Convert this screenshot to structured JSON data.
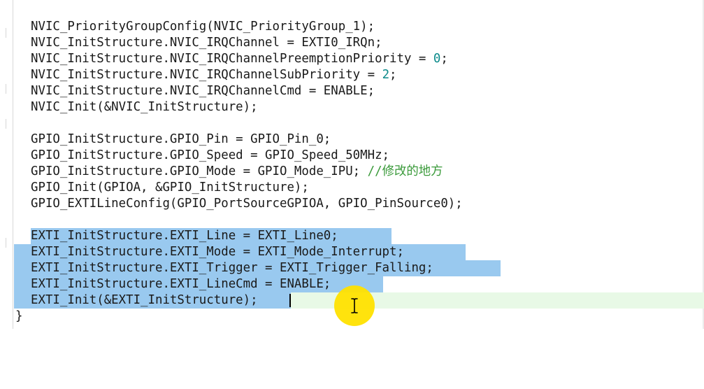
{
  "editor": {
    "lines": [
      {
        "text": "NVIC_PriorityGroupConfig(NVIC_PriorityGroup_1);"
      },
      {
        "text": "NVIC_InitStructure.NVIC_IRQChannel = EXTI0_IRQn;"
      },
      {
        "pre": "NVIC_InitStructure.NVIC_IRQChannelPreemptionPriority = ",
        "num": "0",
        "post": ";"
      },
      {
        "pre": "NVIC_InitStructure.NVIC_IRQChannelSubPriority = ",
        "num": "2",
        "post": ";"
      },
      {
        "text": "NVIC_InitStructure.NVIC_IRQChannelCmd = ENABLE;"
      },
      {
        "text": "NVIC_Init(&NVIC_InitStructure);"
      },
      {
        "text": ""
      },
      {
        "text": "GPIO_InitStructure.GPIO_Pin = GPIO_Pin_0;"
      },
      {
        "text": "GPIO_InitStructure.GPIO_Speed = GPIO_Speed_50MHz;"
      },
      {
        "pre": "GPIO_InitStructure.GPIO_Mode = GPIO_Mode_IPU; ",
        "comment": "//修改的地方"
      },
      {
        "text": "GPIO_Init(GPIOA, &GPIO_InitStructure);"
      },
      {
        "text": "GPIO_EXTILineConfig(GPIO_PortSourceGPIOA, GPIO_PinSource0);"
      },
      {
        "text": ""
      },
      {
        "text": "EXTI_InitStructure.EXTI_Line = EXTI_Line0;"
      },
      {
        "text": "EXTI_InitStructure.EXTI_Mode = EXTI_Mode_Interrupt;"
      },
      {
        "text": "EXTI_InitStructure.EXTI_Trigger = EXTI_Trigger_Falling;"
      },
      {
        "text": "EXTI_InitStructure.EXTI_LineCmd = ENABLE;"
      },
      {
        "text": "EXTI_Init(&EXTI_InitStructure);"
      },
      {
        "text": "}"
      }
    ]
  },
  "colors": {
    "selection": "#99c9ef",
    "current_line": "#e8f9e6",
    "number": "#0a8a8a",
    "comment": "#3a9a3a",
    "cursor_highlight": "#ffe100"
  },
  "cursor": {
    "icon": "i-beam-cursor-icon"
  }
}
